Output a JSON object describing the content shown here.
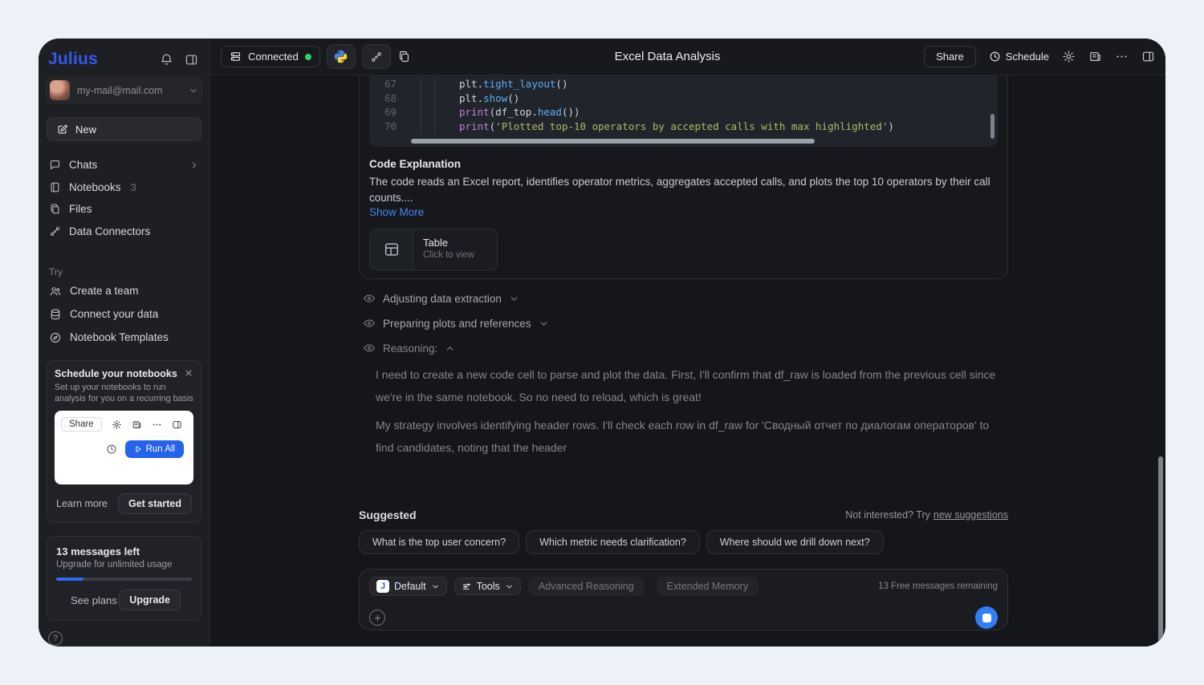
{
  "colors": {
    "accent_blue": "#2563eb",
    "logo_blue": "#2d5bee",
    "link_blue": "#3f87f7",
    "success_green": "#2bd36f",
    "send_blue": "#2f7ff7",
    "code_bg": "#21252b"
  },
  "sidebar": {
    "logo": "Julius",
    "email": "my-mail@mail.com",
    "new_label": "New",
    "nav": [
      {
        "label": "Chats"
      },
      {
        "label": "Notebooks",
        "badge": "3"
      },
      {
        "label": "Files"
      },
      {
        "label": "Data Connectors"
      }
    ],
    "try": {
      "heading": "Try",
      "items": [
        {
          "label": "Create a team"
        },
        {
          "label": "Connect your data"
        },
        {
          "label": "Notebook Templates"
        }
      ]
    },
    "promo": {
      "title": "Schedule your notebooks",
      "description": "Set up your notebooks to run analysis for you on a recurring basis",
      "preview": {
        "share": "Share",
        "run_all": "Run All"
      },
      "learn_more": "Learn more",
      "get_started": "Get started"
    },
    "usage": {
      "title": "13 messages left",
      "subtitle": "Upgrade for unlimited usage",
      "progress_percent": 20,
      "see_plans": "See plans",
      "upgrade": "Upgrade"
    }
  },
  "topbar": {
    "connected": "Connected",
    "title": "Excel Data Analysis",
    "share": "Share",
    "schedule": "Schedule"
  },
  "notebook": {
    "code": {
      "lines": [
        {
          "num": "67",
          "tokens": [
            {
              "t": "plt.",
              "c": "tok-pl"
            },
            {
              "t": "tight_layout",
              "c": "tok-fn"
            },
            {
              "t": "()",
              "c": "tok-pl"
            }
          ]
        },
        {
          "num": "68",
          "tokens": [
            {
              "t": "plt.",
              "c": "tok-pl"
            },
            {
              "t": "show",
              "c": "tok-fn"
            },
            {
              "t": "()",
              "c": "tok-pl"
            }
          ]
        },
        {
          "num": "69",
          "tokens": [
            {
              "t": "print",
              "c": "tok-kw"
            },
            {
              "t": "(df_top.",
              "c": "tok-pl"
            },
            {
              "t": "head",
              "c": "tok-fn"
            },
            {
              "t": "())",
              "c": "tok-pl"
            }
          ]
        },
        {
          "num": "70",
          "tokens": [
            {
              "t": "print",
              "c": "tok-kw"
            },
            {
              "t": "(",
              "c": "tok-pl"
            },
            {
              "t": "'Plotted top-10 operators by accepted calls with max highlighted'",
              "c": "tok-str"
            },
            {
              "t": ")",
              "c": "tok-pl"
            }
          ]
        }
      ]
    },
    "explanation": {
      "title": "Code Explanation",
      "body": "The code reads an Excel report, identifies operator metrics, aggregates accepted calls, and plots the top 10 operators by their call counts....",
      "show_more": "Show More"
    },
    "table_card": {
      "title": "Table",
      "subtitle": "Click to view"
    },
    "sections": [
      {
        "label": "Adjusting data extraction"
      },
      {
        "label": "Preparing plots and references"
      },
      {
        "label": "Reasoning:"
      }
    ],
    "reasoning": {
      "para1": "I need to create a new code cell to parse and plot the data. First, I'll confirm that df_raw is loaded from the previous cell since we're in the same notebook. So no need to reload, which is great!",
      "para2": "My strategy involves identifying header rows. I'll check each row in df_raw for 'Сводный отчет по диалогам операторов' to find candidates, noting that the header"
    }
  },
  "suggested": {
    "heading": "Suggested",
    "not_interested": "Not interested? Try",
    "new_suggestions": "new suggestions",
    "chips": [
      {
        "label": "What is the top user concern?"
      },
      {
        "label": "Which metric needs clarification?"
      },
      {
        "label": "Where should we drill down next?"
      }
    ]
  },
  "composer": {
    "model_badge": "J",
    "model": "Default",
    "tools": "Tools",
    "mode_chips": [
      {
        "label": "Advanced Reasoning"
      },
      {
        "label": "Extended Memory"
      }
    ],
    "remaining": "13 Free messages remaining"
  }
}
